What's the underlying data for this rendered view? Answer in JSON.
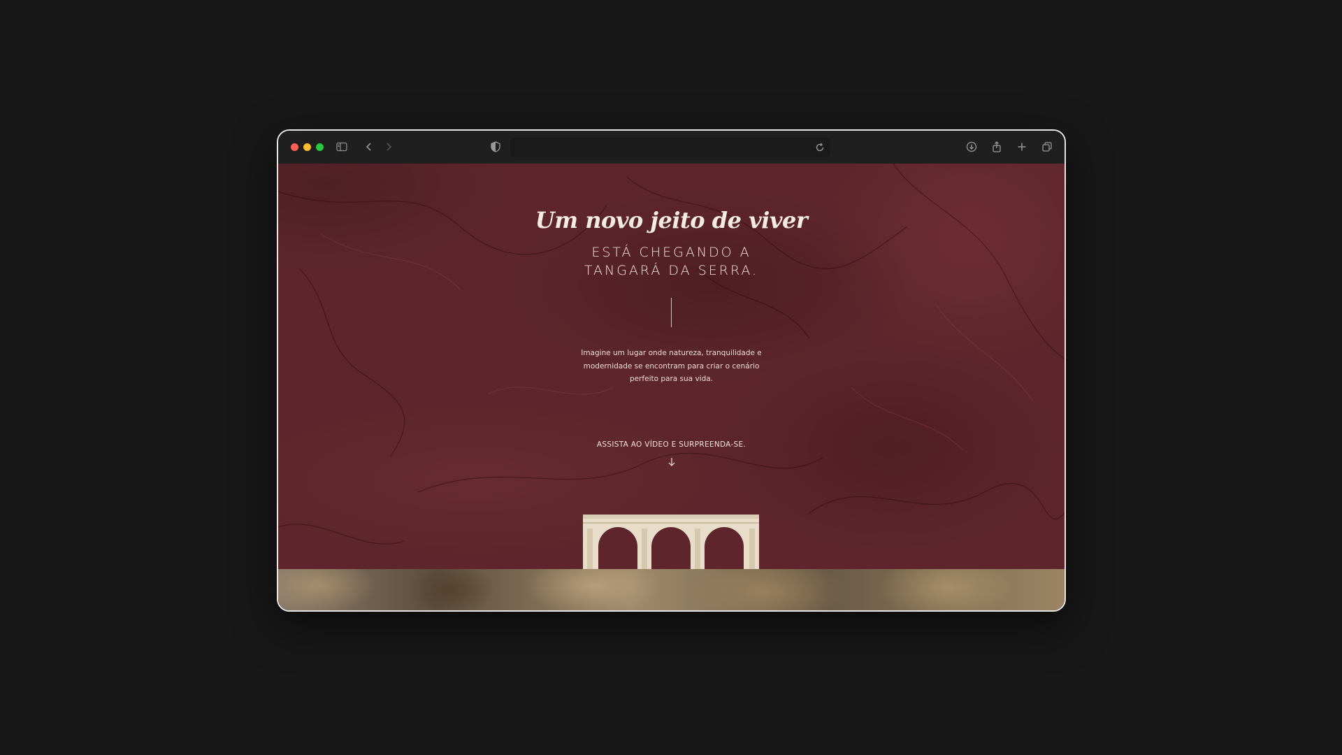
{
  "browser": {
    "icons": {
      "sidebar": "sidebar-icon",
      "back": "chevron-left-icon",
      "forward": "chevron-right-icon",
      "privacy": "shield-icon",
      "reload": "reload-icon",
      "download": "download-icon",
      "share": "share-icon",
      "new_tab": "plus-icon",
      "tabs": "tabs-overview-icon"
    }
  },
  "hero": {
    "script_title": "Um novo jeito de viver",
    "caps_title": "ESTÁ CHEGANDO A TANGARÁ DA SERRA.",
    "lead": "Imagine um lugar onde natureza, tranquilidade e modernidade se encontram para criar o cenário perfeito para sua vida.",
    "cta": "ASSISTA AO VÍDEO E SURPREENDA-SE.",
    "background_color": "#5e262c",
    "text_color": "#f2e6de"
  }
}
